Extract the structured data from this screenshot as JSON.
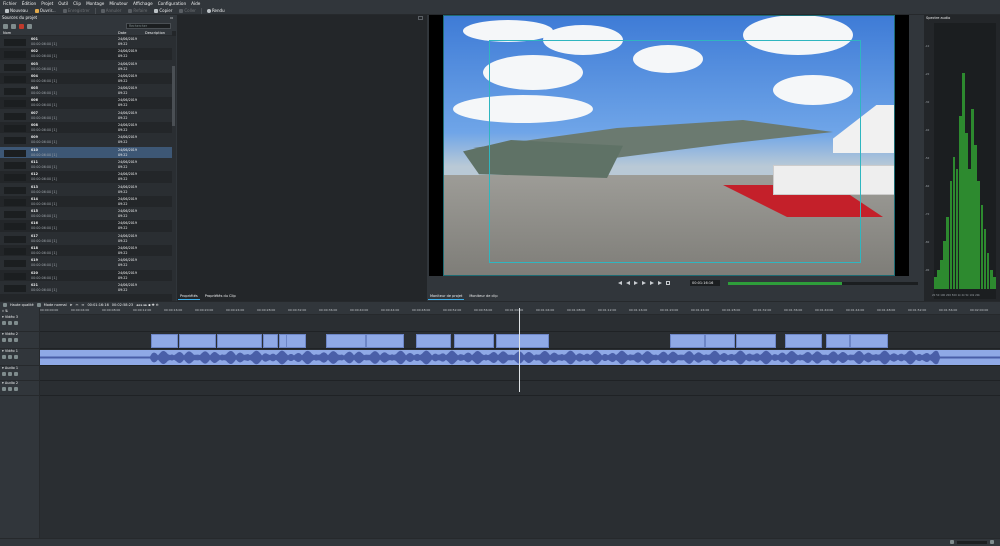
{
  "menu": [
    "Fichier",
    "Édition",
    "Projet",
    "Outil",
    "Clip",
    "Montage",
    "Minuteur",
    "Affichage",
    "Configuration",
    "Aide"
  ],
  "toolbar": {
    "new": "Nouveau",
    "open": "Ouvrir...",
    "save": "Enregistrer",
    "undo": "Annuler",
    "redo": "Refaire",
    "copy": "Copier",
    "paste": "Coller",
    "render": "Rendu"
  },
  "bin": {
    "title": "Sources du projet",
    "search_placeholder": "Rechercher",
    "columns": [
      "Nom",
      "Date",
      "Description"
    ],
    "rows": [
      {
        "name": "001",
        "dur": "00:00:06:00 [1]",
        "date": "24/06/2019",
        "time": "09:22"
      },
      {
        "name": "002",
        "dur": "00:00:06:00 [1]",
        "date": "24/06/2019",
        "time": "09:22"
      },
      {
        "name": "003",
        "dur": "00:00:06:00 [1]",
        "date": "24/06/2019",
        "time": "09:22"
      },
      {
        "name": "004",
        "dur": "00:00:06:00 [1]",
        "date": "24/06/2019",
        "time": "09:22"
      },
      {
        "name": "005",
        "dur": "00:00:06:00 [1]",
        "date": "24/06/2019",
        "time": "09:22"
      },
      {
        "name": "006",
        "dur": "00:00:06:00 [1]",
        "date": "24/06/2019",
        "time": "09:22"
      },
      {
        "name": "007",
        "dur": "00:00:06:00 [1]",
        "date": "24/06/2019",
        "time": "09:22"
      },
      {
        "name": "008",
        "dur": "00:00:06:00 [1]",
        "date": "24/06/2019",
        "time": "09:22"
      },
      {
        "name": "009",
        "dur": "00:00:06:00 [1]",
        "date": "24/06/2019",
        "time": "09:22"
      },
      {
        "name": "010",
        "dur": "00:00:06:00 [1]",
        "date": "24/06/2019",
        "time": "09:22",
        "selected": true
      },
      {
        "name": "011",
        "dur": "00:00:06:00 [1]",
        "date": "24/06/2019",
        "time": "09:22"
      },
      {
        "name": "012",
        "dur": "00:00:06:00 [1]",
        "date": "24/06/2019",
        "time": "09:22"
      },
      {
        "name": "013",
        "dur": "00:00:06:00 [1]",
        "date": "24/06/2019",
        "time": "09:22"
      },
      {
        "name": "014",
        "dur": "00:00:06:00 [1]",
        "date": "24/06/2019",
        "time": "09:22"
      },
      {
        "name": "015",
        "dur": "00:00:06:00 [1]",
        "date": "24/06/2019",
        "time": "09:22"
      },
      {
        "name": "016",
        "dur": "00:00:06:00 [1]",
        "date": "24/06/2019",
        "time": "09:22"
      },
      {
        "name": "017",
        "dur": "00:00:06:00 [1]",
        "date": "24/06/2019",
        "time": "09:22"
      },
      {
        "name": "018",
        "dur": "00:00:06:00 [1]",
        "date": "24/06/2019",
        "time": "09:22"
      },
      {
        "name": "019",
        "dur": "00:00:06:00 [1]",
        "date": "24/06/2019",
        "time": "09:22"
      },
      {
        "name": "020",
        "dur": "00:00:06:00 [1]",
        "date": "24/06/2019",
        "time": "09:22"
      },
      {
        "name": "021",
        "dur": "00:00:06:00 [1]",
        "date": "24/06/2019",
        "time": "09:22"
      }
    ]
  },
  "bin_tabs": [
    "Propriétés",
    "Propriétés du Clip"
  ],
  "monitor": {
    "timecode": "00:01:16:16",
    "tabs": [
      "Moniteur de projet",
      "Moniteur de clip"
    ]
  },
  "spectrum": {
    "title": "Spectre audio",
    "ylabels": [
      "-10",
      "-20",
      "-30",
      "-40",
      "-50",
      "-60",
      "-70",
      "-80",
      "-90"
    ],
    "xlabels": "20 50 100 200 500 1k 2k 5k 10k 20k",
    "levels": [
      0.05,
      0.08,
      0.12,
      0.2,
      0.3,
      0.45,
      0.55,
      0.5,
      0.72,
      0.9,
      0.65,
      0.5,
      0.75,
      0.6,
      0.45,
      0.35,
      0.25,
      0.15,
      0.08,
      0.05
    ]
  },
  "timeline_toolbar": {
    "quality": "Haute qualité",
    "mode": "Mode normal",
    "position": "00:01:16:16",
    "duration": "00:02:58:23"
  },
  "ruler": [
    "00:00:00:00",
    "00:00:04:00",
    "00:00:08:00",
    "00:00:12:00",
    "00:00:16:00",
    "00:00:20:00",
    "00:00:24:00",
    "00:00:28:00",
    "00:00:32:00",
    "00:00:36:00",
    "00:00:40:00",
    "00:00:44:00",
    "00:00:48:00",
    "00:00:52:00",
    "00:00:56:00",
    "00:01:00:00",
    "00:01:04:00",
    "00:01:08:00",
    "00:01:12:00",
    "00:01:16:00",
    "00:01:20:00",
    "00:01:24:00",
    "00:01:28:00",
    "00:01:32:00",
    "00:01:36:00",
    "00:01:40:00",
    "00:01:44:00",
    "00:01:48:00",
    "00:01:52:00",
    "00:01:56:00",
    "00:02:00:00"
  ],
  "tracks": [
    "Vidéo 3",
    "Vidéo 2",
    "Vidéo 1",
    "Audio 1",
    "Audio 2"
  ],
  "colors": {
    "clip": "#8fa9e6",
    "selection": "#3d5775",
    "accent": "#3daee9",
    "spectrum": "#2d8a2f"
  }
}
